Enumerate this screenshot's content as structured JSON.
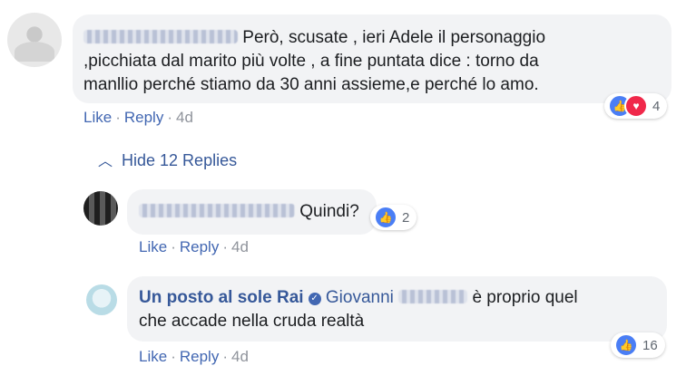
{
  "comment1": {
    "text_line1": "Però, scusate , ieri Adele il personaggio",
    "text_line2": ",picchiata dal marito più volte , a fine puntata dice : torno da",
    "text_line3": "manllio perché stiamo da 30 anni assieme,e perché lo amo.",
    "like": "Like",
    "reply": "Reply",
    "time": "4d",
    "reaction_count": "4"
  },
  "hide_replies": {
    "label": "Hide 12 Replies"
  },
  "reply1": {
    "text": "Quindi?",
    "like": "Like",
    "reply": "Reply",
    "time": "4d",
    "reaction_count": "2"
  },
  "reply2": {
    "author": "Un posto al sole Rai",
    "mention_first": "Giovanni",
    "text_line1_end": "è proprio quel",
    "text_line2": "che accade nella cruda realtà",
    "like": "Like",
    "reply": "Reply",
    "time": "4d",
    "reaction_count": "16"
  },
  "icons": {
    "like": "like-reaction-icon",
    "love": "love-reaction-icon",
    "chevron": "chevron-up-icon",
    "verified": "verified-badge-icon"
  },
  "colors": {
    "link": "#4267b2",
    "author": "#365899",
    "bubble": "#f2f3f5",
    "like_blue": "#4a7ef5",
    "love_red": "#f0284a"
  }
}
